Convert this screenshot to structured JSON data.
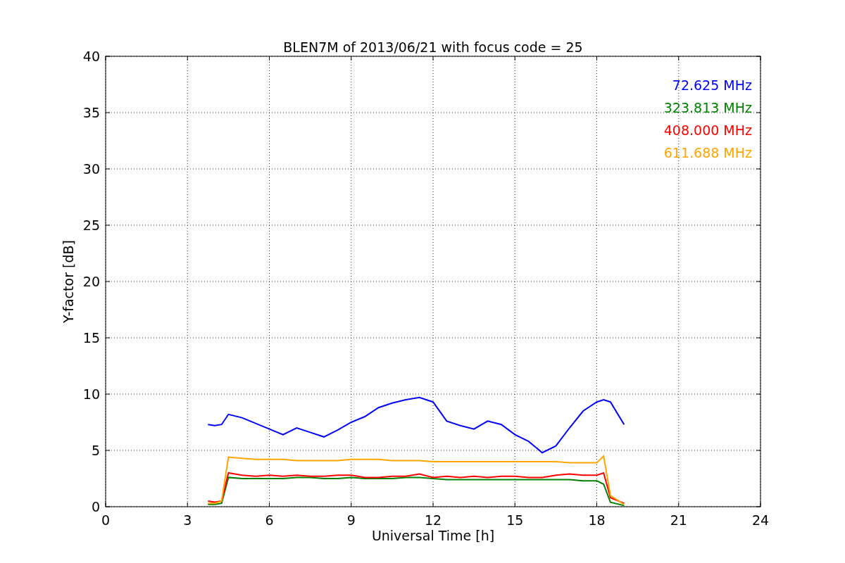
{
  "chart_data": {
    "type": "line",
    "title": "BLEN7M of 2013/06/21 with focus code = 25",
    "xlabel": "Universal Time [h]",
    "ylabel": "Y-factor [dB]",
    "xlim": [
      0,
      24
    ],
    "ylim": [
      0,
      40
    ],
    "xticks": [
      0,
      3,
      6,
      9,
      12,
      15,
      18,
      21,
      24
    ],
    "yticks": [
      0,
      5,
      10,
      15,
      20,
      25,
      30,
      35,
      40
    ],
    "grid": true,
    "x": [
      3.75,
      4,
      4.25,
      4.5,
      5,
      5.5,
      6,
      6.5,
      7,
      7.5,
      8,
      8.5,
      9,
      9.5,
      10,
      10.5,
      11,
      11.5,
      12,
      12.5,
      13,
      13.5,
      14,
      14.5,
      15,
      15.5,
      16,
      16.5,
      17,
      17.5,
      18,
      18.25,
      18.5,
      19
    ],
    "series": [
      {
        "name": "72.625 MHz",
        "color": "#0000ff",
        "values": [
          7.3,
          7.2,
          7.3,
          8.2,
          7.9,
          7.4,
          6.9,
          6.4,
          7,
          6.6,
          6.2,
          6.8,
          7.5,
          8,
          8.8,
          9.2,
          9.5,
          9.7,
          9.3,
          7.6,
          7.2,
          6.9,
          7.6,
          7.3,
          6.4,
          5.8,
          4.8,
          5.4,
          7,
          8.5,
          9.3,
          9.5,
          9.3,
          7.3
        ]
      },
      {
        "name": "323.813 MHz",
        "color": "#008000",
        "values": [
          0.2,
          0.2,
          0.3,
          2.6,
          2.5,
          2.5,
          2.5,
          2.5,
          2.6,
          2.6,
          2.5,
          2.5,
          2.6,
          2.5,
          2.5,
          2.5,
          2.6,
          2.6,
          2.5,
          2.4,
          2.4,
          2.4,
          2.4,
          2.4,
          2.4,
          2.4,
          2.4,
          2.4,
          2.4,
          2.3,
          2.3,
          2.0,
          0.4,
          0.1
        ]
      },
      {
        "name": "408.000 MHz",
        "color": "#ff0000",
        "values": [
          0.5,
          0.4,
          0.5,
          3.0,
          2.8,
          2.7,
          2.8,
          2.7,
          2.8,
          2.7,
          2.7,
          2.8,
          2.8,
          2.6,
          2.6,
          2.7,
          2.7,
          2.9,
          2.6,
          2.7,
          2.6,
          2.7,
          2.6,
          2.7,
          2.7,
          2.6,
          2.6,
          2.8,
          2.9,
          2.8,
          2.8,
          3.0,
          0.8,
          0.3
        ]
      },
      {
        "name": "611.688 MHz",
        "color": "#ffa500",
        "values": [
          0.3,
          0.3,
          0.5,
          4.4,
          4.3,
          4.2,
          4.2,
          4.2,
          4.1,
          4.1,
          4.1,
          4.1,
          4.2,
          4.2,
          4.2,
          4.1,
          4.1,
          4.1,
          4.0,
          4.0,
          4.0,
          4.0,
          4.0,
          4.0,
          4.0,
          4.0,
          4.0,
          4.0,
          3.9,
          3.9,
          3.9,
          4.5,
          1.0,
          0.2
        ]
      }
    ]
  }
}
